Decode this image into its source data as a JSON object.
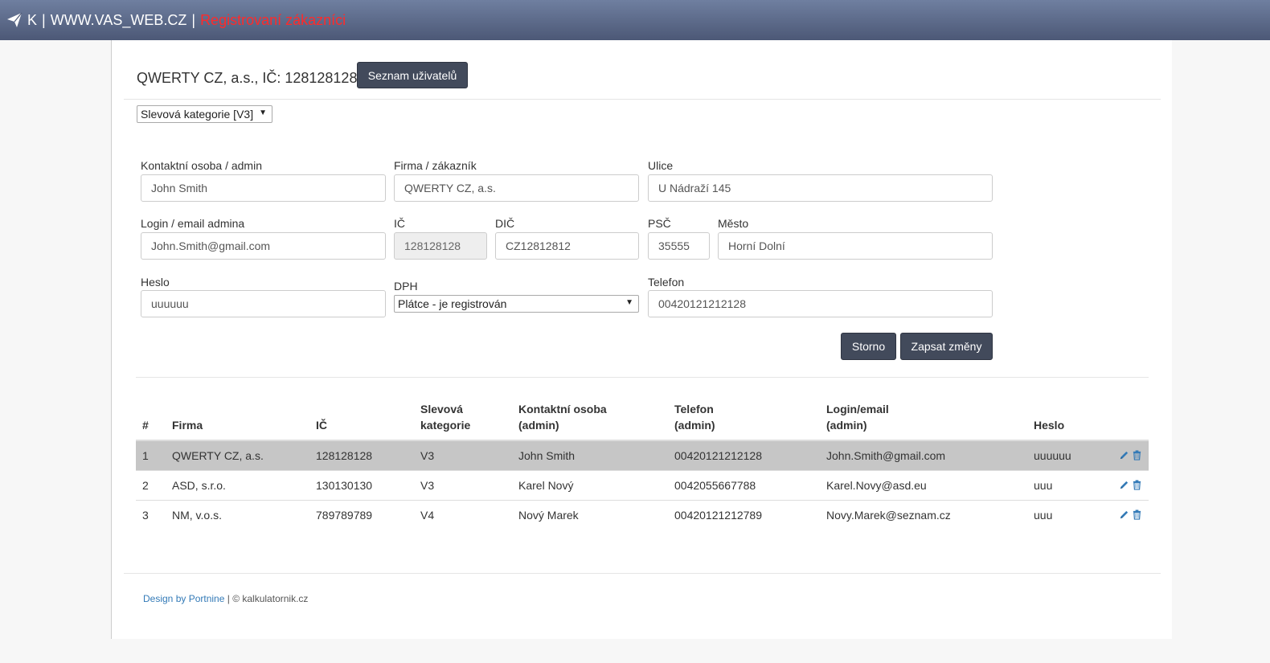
{
  "header": {
    "brand": "K",
    "site": "WWW.VAS_WEB.CZ",
    "section": "Registrovaní zákazníci",
    "separator": "|"
  },
  "company": {
    "title": "QWERTY CZ, a.s.,  IČ: 128128128",
    "users_button": "Seznam uživatelů",
    "discount_select": "Slevová kategorie [V3]"
  },
  "form": {
    "contact_label": "Kontaktní osoba / admin",
    "contact_value": "John Smith",
    "company_label": "Firma / zákazník",
    "company_value": "QWERTY CZ, a.s.",
    "street_label": "Ulice",
    "street_value": "U Nádraží 145",
    "login_label": "Login / email admina",
    "login_value": "John.Smith@gmail.com",
    "ic_label": "IČ",
    "ic_value": "128128128",
    "dic_label": "DIČ",
    "dic_value": "CZ12812812",
    "psc_label": "PSČ",
    "psc_value": "35555",
    "city_label": "Město",
    "city_value": "Horní Dolní",
    "password_label": "Heslo",
    "password_value": "uuuuuu",
    "vat_label": "DPH",
    "vat_value": "Plátce - je registrován",
    "phone_label": "Telefon",
    "phone_value": "00420121212128",
    "cancel_button": "Storno",
    "save_button": "Zapsat změny"
  },
  "table": {
    "headers": {
      "num": "#",
      "firm": "Firma",
      "ic": "IČ",
      "discount_1": "Slevová",
      "discount_2": "kategorie",
      "contact_1": "Kontaktní osoba",
      "contact_2": "(admin)",
      "phone_1": "Telefon",
      "phone_2": "(admin)",
      "login_1": "Login/email",
      "login_2": "(admin)",
      "password": "Heslo"
    },
    "rows": [
      {
        "num": "1",
        "firm": "QWERTY CZ, a.s.",
        "ic": "128128128",
        "discount": "V3",
        "contact": "John Smith",
        "phone": "00420121212128",
        "login": "John.Smith@gmail.com",
        "password": "uuuuuu"
      },
      {
        "num": "2",
        "firm": "ASD, s.r.o.",
        "ic": "130130130",
        "discount": "V3",
        "contact": "Karel Nový",
        "phone": "0042055667788",
        "login": "Karel.Novy@asd.eu",
        "password": "uuu"
      },
      {
        "num": "3",
        "firm": "NM, v.o.s.",
        "ic": "789789789",
        "discount": "V4",
        "contact": "Nový Marek",
        "phone": "00420121212789",
        "login": "Novy.Marek@seznam.cz",
        "password": "uuu"
      }
    ]
  },
  "footer": {
    "design": "Design by Portnine",
    "separator": "|",
    "copyright": "© kalkulatornik.cz"
  },
  "colors": {
    "header_top": "#6f7fa0",
    "header_bottom": "#4c5876",
    "accent_red": "#ff2a2a",
    "button": "#424a5b",
    "link": "#337ab7",
    "selected_row": "#c6c6c6"
  }
}
